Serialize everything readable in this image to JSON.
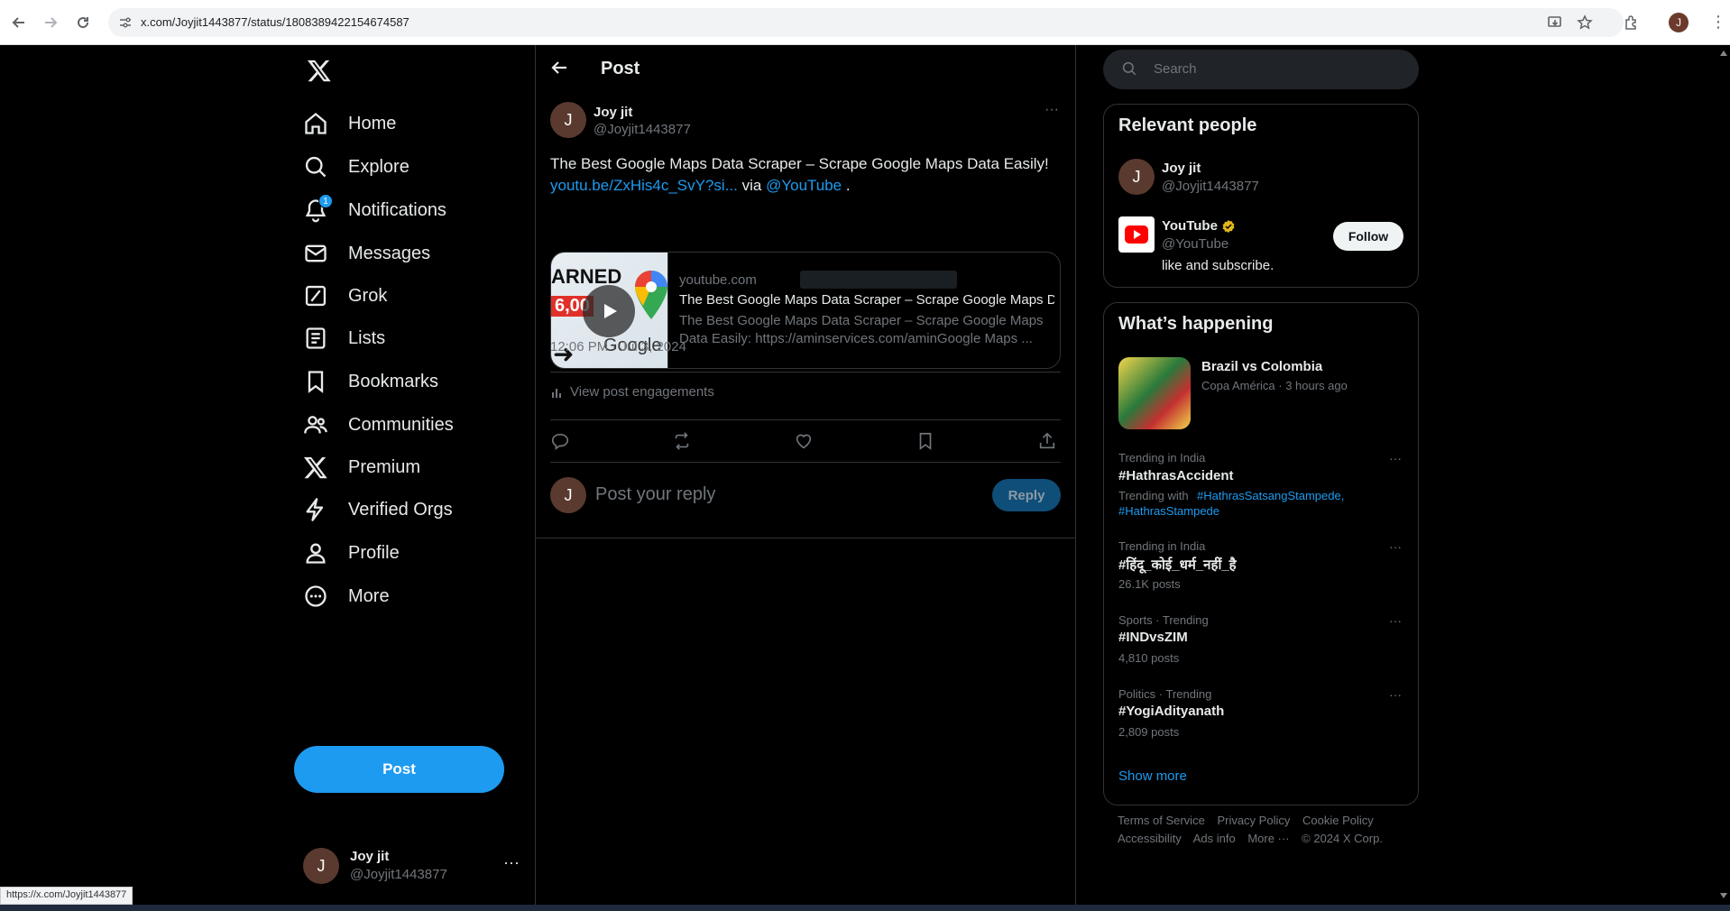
{
  "browser": {
    "url": "x.com/Joyjit1443877/status/1808389422154674587",
    "status_url": "https://x.com/Joyjit1443877"
  },
  "nav": {
    "items": [
      {
        "label": "Home",
        "icon": "home-icon"
      },
      {
        "label": "Explore",
        "icon": "search-icon"
      },
      {
        "label": "Notifications",
        "icon": "bell-icon",
        "badge": "1"
      },
      {
        "label": "Messages",
        "icon": "envelope-icon"
      },
      {
        "label": "Grok",
        "icon": "grok-icon"
      },
      {
        "label": "Lists",
        "icon": "list-icon"
      },
      {
        "label": "Bookmarks",
        "icon": "bookmark-icon"
      },
      {
        "label": "Communities",
        "icon": "people-icon"
      },
      {
        "label": "Premium",
        "icon": "x-icon"
      },
      {
        "label": "Verified Orgs",
        "icon": "lightning-icon"
      },
      {
        "label": "Profile",
        "icon": "person-icon"
      },
      {
        "label": "More",
        "icon": "more-circle-icon"
      }
    ],
    "post_button": "Post",
    "account": {
      "initial": "J",
      "name": "Joy jit",
      "handle": "@Joyjit1443877"
    }
  },
  "main": {
    "header_title": "Post",
    "post": {
      "initial": "J",
      "name": "Joy jit",
      "handle": "@Joyjit1443877",
      "text": "The Best Google Maps Data Scraper – Scrape Google Maps Data Easily!",
      "link": "youtu.be/ZxHis4c_SvY?si...",
      "via": "via",
      "mention": "@YouTube",
      "trailing": ".",
      "card": {
        "domain": "youtube.com",
        "title": "The Best Google Maps Data Scraper – Scrape Google Maps Data Easily!",
        "description": "The Best Google Maps Data Scraper – Scrape Google Maps Data Easily: https://aminservices.com/aminGoogle Maps ...",
        "thumb_text_1": "ARNED",
        "thumb_text_2": "6,00",
        "thumb_text_3": "Google"
      },
      "timestamp": "12:06 PM · Jul 3, 2024",
      "engagements": "View post engagements"
    },
    "reply": {
      "initial": "J",
      "placeholder": "Post your reply",
      "button": "Reply"
    }
  },
  "right": {
    "search_placeholder": "Search",
    "relevant": {
      "title": "Relevant people",
      "people": [
        {
          "initial": "J",
          "name": "Joy jit",
          "handle": "@Joyjit1443877"
        },
        {
          "name": "YouTube",
          "handle": "@YouTube",
          "bio": "like and subscribe.",
          "follow": "Follow"
        }
      ]
    },
    "happening": {
      "title": "What’s happening",
      "featured": {
        "title": "Brazil vs Colombia",
        "meta": "Copa América · 3 hours ago"
      },
      "trends": [
        {
          "context": "Trending in India",
          "title": "#HathrasAccident",
          "extra_prefix": "Trending with",
          "extra_tags": "#HathrasSatsangStampede,",
          "extra_tags2": "#HathrasStampede"
        },
        {
          "context": "Trending in India",
          "title": "#हिंदू_कोई_धर्म_नहीं_है",
          "posts": "26.1K posts"
        },
        {
          "context": "Sports · Trending",
          "title": "#INDvsZIM",
          "posts": "4,810 posts"
        },
        {
          "context": "Politics · Trending",
          "title": "#YogiAdityanath",
          "posts": "2,809 posts"
        }
      ],
      "show_more": "Show more"
    },
    "footer": {
      "links": [
        "Terms of Service",
        "Privacy Policy",
        "Cookie Policy",
        "Accessibility",
        "Ads info",
        "More ···",
        "© 2024 X Corp."
      ]
    }
  }
}
